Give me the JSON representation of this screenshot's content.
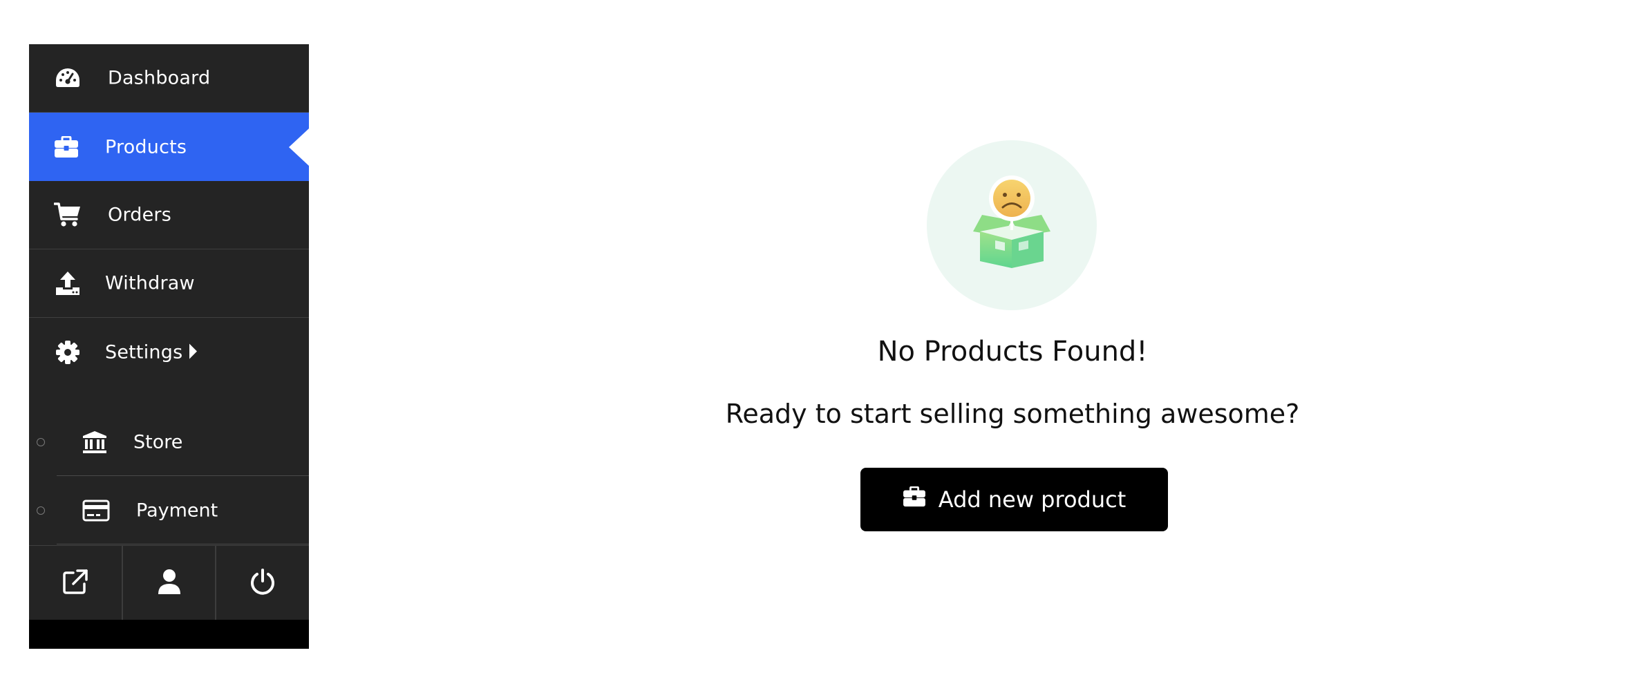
{
  "sidebar": {
    "items": [
      {
        "label": "Dashboard",
        "icon": "dashboard-gauge-icon",
        "active": false
      },
      {
        "label": "Products",
        "icon": "briefcase-icon",
        "active": true
      },
      {
        "label": "Orders",
        "icon": "shopping-cart-icon",
        "active": false
      },
      {
        "label": "Withdraw",
        "icon": "upload-icon",
        "active": false
      },
      {
        "label": "Settings",
        "icon": "gear-icon",
        "active": false,
        "expanded": true
      }
    ],
    "sub_items": [
      {
        "label": "Store",
        "icon": "bank-icon"
      },
      {
        "label": "Payment",
        "icon": "credit-card-icon"
      }
    ],
    "bottom_actions": [
      {
        "icon": "external-link-icon"
      },
      {
        "icon": "user-icon"
      },
      {
        "icon": "power-icon"
      }
    ],
    "colors": {
      "background": "#242424",
      "active": "#2f64f2",
      "footer": "#000000"
    }
  },
  "empty_state": {
    "illustration": "sad-empty-box-icon",
    "title": "No Products Found!",
    "subtitle": "Ready to start selling something awesome?",
    "button_label": "Add new product",
    "button_icon": "briefcase-icon"
  }
}
